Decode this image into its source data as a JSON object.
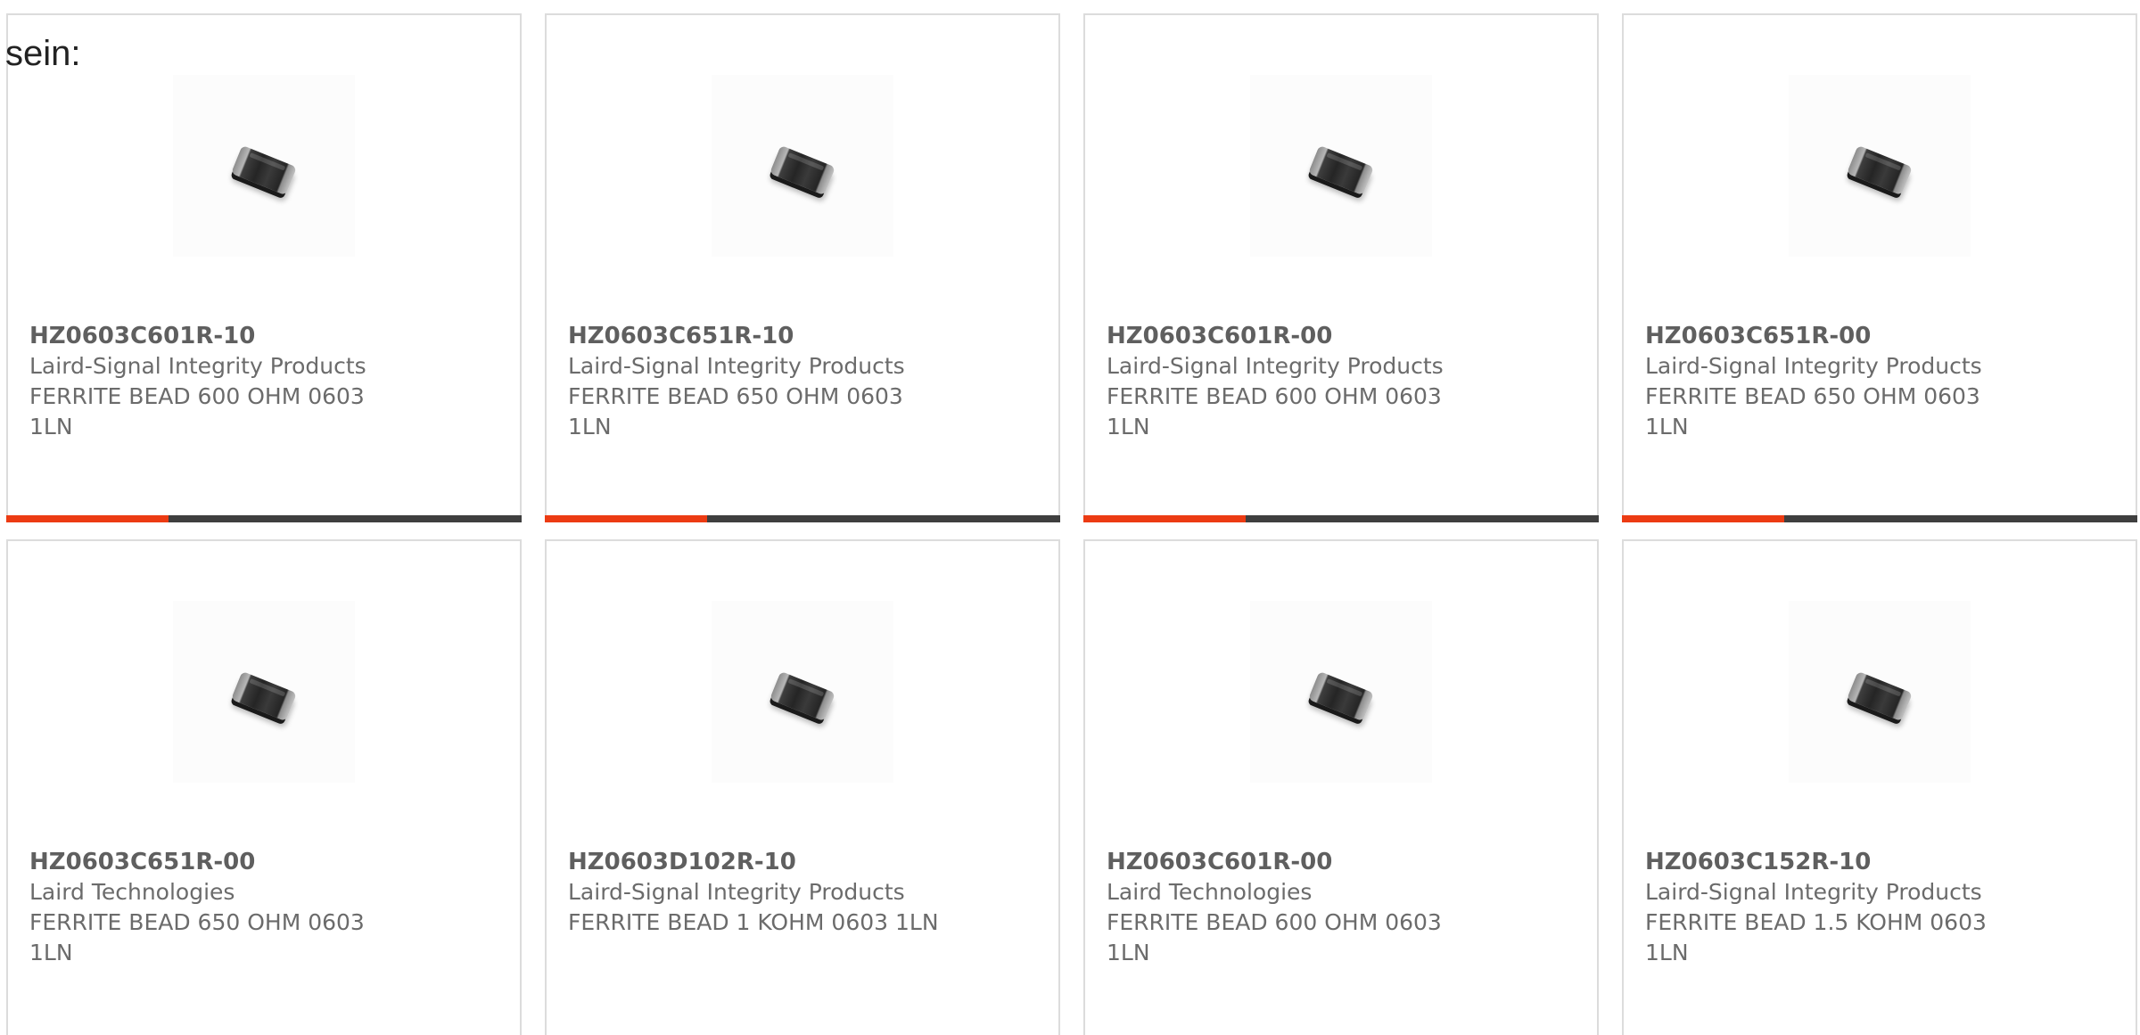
{
  "heading": "sein:",
  "products": [
    {
      "part_number": "HZ0603C601R-10",
      "manufacturer": "Laird-Signal Integrity Products",
      "description": "FERRITE BEAD 600 OHM 0603 1LN",
      "image_icon": "ferrite-bead-chip-icon",
      "progress": 0.315
    },
    {
      "part_number": "HZ0603C651R-10",
      "manufacturer": "Laird-Signal Integrity Products",
      "description": "FERRITE BEAD 650 OHM 0603 1LN",
      "image_icon": "ferrite-bead-chip-icon",
      "progress": 0.315
    },
    {
      "part_number": "HZ0603C601R-00",
      "manufacturer": "Laird-Signal Integrity Products",
      "description": "FERRITE BEAD 600 OHM 0603 1LN",
      "image_icon": "ferrite-bead-chip-icon",
      "progress": 0.315
    },
    {
      "part_number": "HZ0603C651R-00",
      "manufacturer": "Laird-Signal Integrity Products",
      "description": "FERRITE BEAD 650 OHM 0603 1LN",
      "image_icon": "ferrite-bead-chip-icon",
      "progress": 0.315
    },
    {
      "part_number": "HZ0603C651R-00",
      "manufacturer": "Laird Technologies",
      "description": "FERRITE BEAD 650 OHM 0603 1LN",
      "image_icon": "ferrite-bead-chip-icon"
    },
    {
      "part_number": "HZ0603D102R-10",
      "manufacturer": "Laird-Signal Integrity Products",
      "description": "FERRITE BEAD 1 KOHM 0603 1LN",
      "image_icon": "ferrite-bead-chip-icon"
    },
    {
      "part_number": "HZ0603C601R-00",
      "manufacturer": "Laird Technologies",
      "description": "FERRITE BEAD 600 OHM 0603 1LN",
      "image_icon": "ferrite-bead-chip-icon"
    },
    {
      "part_number": "HZ0603C152R-10",
      "manufacturer": "Laird-Signal Integrity Products",
      "description": "FERRITE BEAD 1.5 KOHM 0603 1LN",
      "image_icon": "ferrite-bead-chip-icon"
    }
  ],
  "colors": {
    "accent": "#ec3b13",
    "track": "#3f3f3f",
    "card_border": "#dcdcdc",
    "text_muted": "#6b6b6b"
  }
}
